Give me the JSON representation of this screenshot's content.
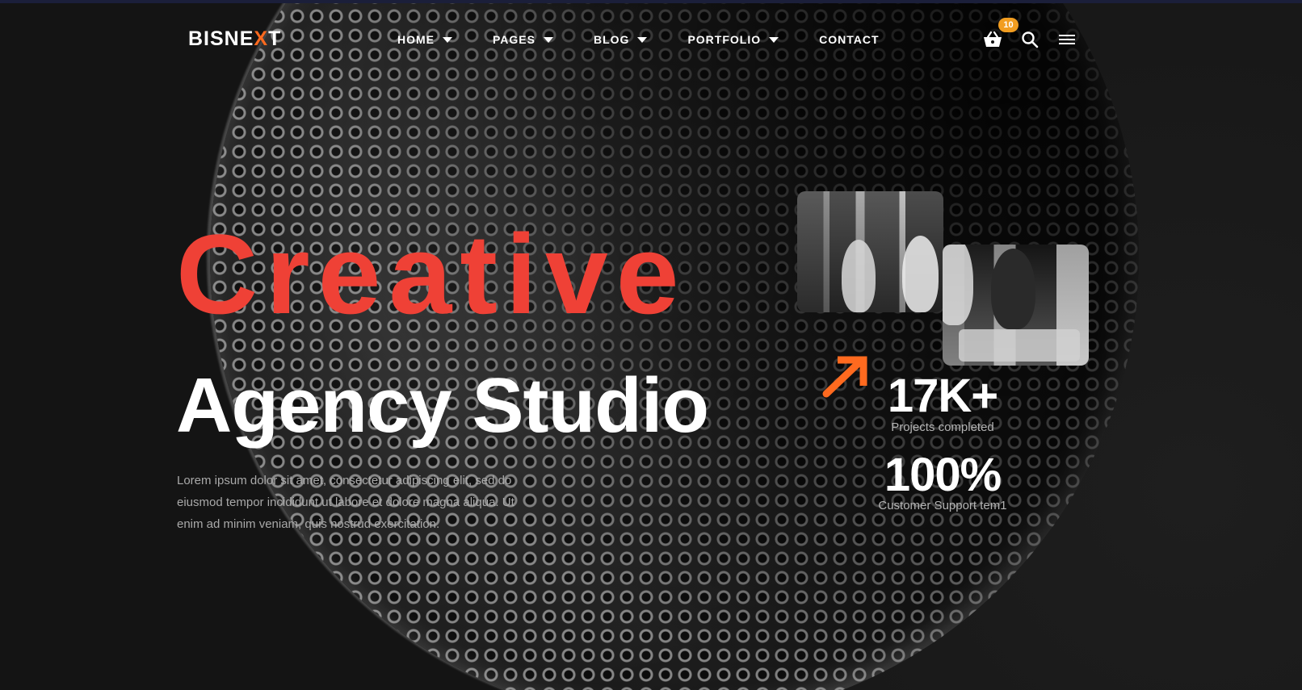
{
  "header": {
    "logo_prefix": "BISNE",
    "logo_x": "X",
    "logo_suffix": "T",
    "nav": [
      {
        "label": "HOME",
        "has_dropdown": true
      },
      {
        "label": "PAGES",
        "has_dropdown": true
      },
      {
        "label": "BLOG",
        "has_dropdown": true
      },
      {
        "label": "PORTFOLIO",
        "has_dropdown": true
      },
      {
        "label": "CONTACT",
        "has_dropdown": false
      }
    ],
    "cart_count": "10",
    "icons": [
      "cart-icon",
      "search-icon",
      "menu-icon"
    ]
  },
  "hero": {
    "title_line1": "Creative",
    "title_line2": "Agency Studio",
    "description": "Lorem ipsum dolor sit amet, consectetur adipiscing elit, sed do eiusmod tempor incididunt ut labore et dolore magna aliqua. Ut enim ad minim veniam, quis nostrud exercitation."
  },
  "stats": [
    {
      "value": "17K+",
      "label": "Projects completed"
    },
    {
      "value": "100%",
      "label": "Customer Support tem1"
    }
  ],
  "colors": {
    "accent_red": "#ef4136",
    "accent_orange": "#ff6a1f",
    "badge": "#f29d20",
    "background": "#121212"
  }
}
